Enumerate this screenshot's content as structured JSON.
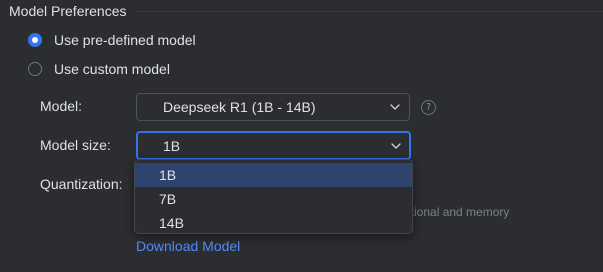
{
  "section": {
    "title": "Model Preferences"
  },
  "model_source": {
    "options": [
      {
        "label": "Use pre-defined model",
        "checked": true
      },
      {
        "label": "Use custom model",
        "checked": false
      }
    ]
  },
  "model": {
    "label": "Model:",
    "value": "Deepseek R1 (1B - 14B)",
    "help_icon": "question-circle-icon",
    "help_glyph": "?"
  },
  "model_size": {
    "label": "Model size:",
    "value": "1B",
    "options": [
      "1B",
      "7B",
      "14B"
    ],
    "selected_index": 0
  },
  "quantization": {
    "label": "Quantization:"
  },
  "requirements_fragment": "rational and memory",
  "download_link": "Download Model",
  "colors": {
    "accent": "#3574f0",
    "link": "#548af7",
    "background": "#2b2d30",
    "selection": "#2e436e"
  }
}
